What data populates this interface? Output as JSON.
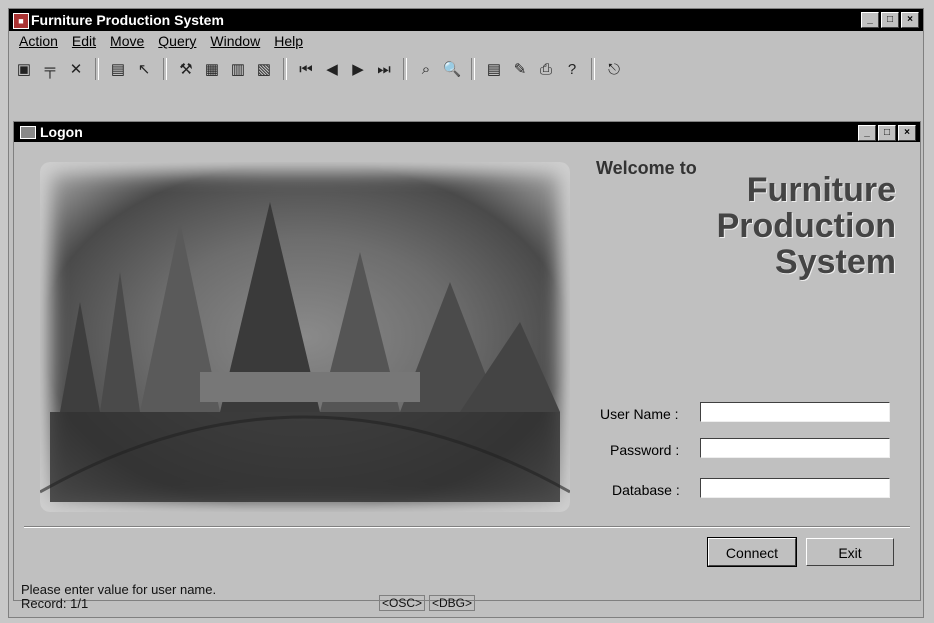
{
  "window": {
    "title": "Furniture Production System",
    "buttons": [
      "_",
      "□",
      "×"
    ]
  },
  "menu": {
    "items": [
      "Action",
      "Edit",
      "Move",
      "Query",
      "Window",
      "Help"
    ]
  },
  "toolbar": {
    "icons": [
      "new-record-icon",
      "add-row-icon",
      "delete-row-icon",
      "save-icon",
      "undo-icon",
      "tools-icon",
      "copy-icon",
      "paste-icon",
      "clear-icon",
      "first-record-icon",
      "prev-record-icon",
      "next-record-icon",
      "last-record-icon",
      "find-icon",
      "zoom-icon",
      "report-icon",
      "edit-icon",
      "print-icon",
      "help-icon",
      "exit-icon"
    ],
    "glyphs": [
      "▣",
      "╤",
      "✕",
      "▤",
      "↖",
      "⚒",
      "▦",
      "▥",
      "▧",
      "⏮",
      "◀",
      "▶",
      "⏭",
      "⌕",
      "🔍",
      "▤",
      "✎",
      "⎙",
      "?",
      "⎋"
    ]
  },
  "logon": {
    "title": "Logon",
    "welcome": "Welcome to",
    "brand_line1": "Furniture",
    "brand_line2": "Production",
    "brand_line3": "System",
    "username_label": "User Name :",
    "password_label": "Password :",
    "database_label": "Database :",
    "username_value": "",
    "password_value": "",
    "database_value": "",
    "connect_label": "Connect",
    "exit_label": "Exit"
  },
  "status": {
    "message": "Please enter value for user name.",
    "record": "Record: 1/1",
    "osc": "<OSC>",
    "dbg": "<DBG>"
  }
}
